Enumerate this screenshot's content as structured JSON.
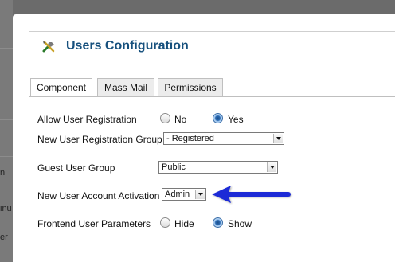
{
  "background": {
    "text_lines": [
      "n",
      "inu",
      "er"
    ]
  },
  "header": {
    "title": "Users Configuration",
    "icon": "tools-icon"
  },
  "tabs": [
    {
      "label": "Component",
      "active": true
    },
    {
      "label": "Mass Mail",
      "active": false
    },
    {
      "label": "Permissions",
      "active": false
    }
  ],
  "form": {
    "allow_registration": {
      "label": "Allow User Registration",
      "options": [
        "No",
        "Yes"
      ],
      "selected": "Yes"
    },
    "new_user_group": {
      "label": "New User Registration Group",
      "value": "- Registered"
    },
    "guest_group": {
      "label": "Guest User Group",
      "value": "Public"
    },
    "account_activation": {
      "label": "New User Account Activation",
      "value": "Admin"
    },
    "frontend_params": {
      "label": "Frontend User Parameters",
      "options": [
        "Hide",
        "Show"
      ],
      "selected": "Show"
    }
  },
  "colors": {
    "title": "#16507d",
    "annotation_arrow": "#1a2bd6"
  }
}
